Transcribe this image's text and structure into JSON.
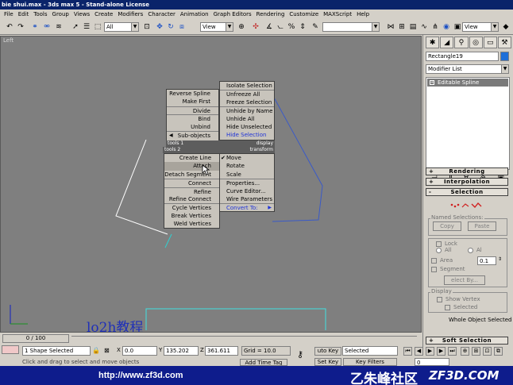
{
  "window": {
    "title": "bie shui.max - 3ds max 5 - Stand-alone License"
  },
  "menu": [
    "File",
    "Edit",
    "Tools",
    "Group",
    "Views",
    "Create",
    "Modifiers",
    "Character",
    "Animation",
    "Graph Editors",
    "Rendering",
    "Customize",
    "MAXScript",
    "Help"
  ],
  "toolbar": {
    "selection_filter": "All",
    "ref_coord": "View",
    "named_selection": "",
    "render_view": "View"
  },
  "viewport": {
    "label": "Left",
    "watermark": "lo2h教程"
  },
  "quad_menu": {
    "tl_items": [
      "Reverse Spline",
      "Make First",
      "Divide",
      "Bind",
      "Unbind",
      "Sub-objects"
    ],
    "tr_items": [
      "Isolate Selection",
      "Unfreeze All",
      "Freeze Selection",
      "Unhide by Name",
      "Unhide All",
      "Hide Unselected",
      "Hide Selection"
    ],
    "headers": {
      "tools1": "tools 1",
      "display": "display",
      "tools2": "tools 2",
      "transform": "transform"
    },
    "bl_items": [
      "Create Line",
      "Attach",
      "Detach Segment",
      "Connect",
      "Refine",
      "Refine Connect",
      "Cycle Vertices",
      "Break Vertices",
      "Weld Vertices"
    ],
    "br_items": [
      "Move",
      "Rotate",
      "Scale",
      "Properties...",
      "Curve Editor...",
      "Wire Parameters",
      "Convert To:"
    ]
  },
  "command_panel": {
    "object_name": "Rectangle19",
    "modifier_list": "Modifier List",
    "stack_item": "Editable Spline",
    "object_color": "#1f6fd8",
    "rollouts": [
      "Rendering",
      "Interpolation",
      "Selection",
      "Soft Selection"
    ],
    "rollout_signs": [
      "+",
      "+",
      "-",
      "+"
    ],
    "named_selections": "Named Selections:",
    "copy": "Copy",
    "paste": "Paste",
    "lock": "Lock",
    "all": "All",
    "al": "Al",
    "area": "Area",
    "area_value": "0.1",
    "segment": "Segment",
    "select_by": "elect By...",
    "display": "Display",
    "show_vertex": "Show Vertex",
    "selected": "Selected",
    "whole_object": "Whole Object Selected"
  },
  "timeline": {
    "frame": "0 / 100"
  },
  "status": {
    "shape_selected": "1 Shape Selected",
    "x_label": "X",
    "x": "0.0",
    "y_label": "Y",
    "y": "135.202",
    "z_label": "Z",
    "z": "361.611",
    "grid": "Grid = 10.0",
    "auto_key": "uto Key",
    "set_key": "Set Key",
    "key_mode": "Selected",
    "key_filters": "Key Filters",
    "frame_field": "0",
    "prompt": "Click and drag to select and move objects",
    "add_time_tag": "Add Time Tag"
  },
  "banner": {
    "url": "http://www.zf3d.com",
    "logo": "乙朱峰社区",
    "site": "ZF3D.COM"
  }
}
